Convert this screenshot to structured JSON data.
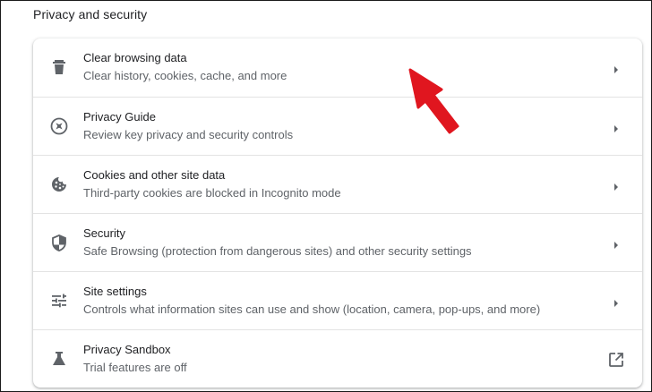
{
  "section": {
    "title": "Privacy and security"
  },
  "rows": [
    {
      "label": "Clear browsing data",
      "sub": "Clear history, cookies, cache, and more",
      "icon": "trash-icon",
      "action": "chevron-right-icon"
    },
    {
      "label": "Privacy Guide",
      "sub": "Review key privacy and security controls",
      "icon": "compass-icon",
      "action": "chevron-right-icon"
    },
    {
      "label": "Cookies and other site data",
      "sub": "Third-party cookies are blocked in Incognito mode",
      "icon": "cookie-icon",
      "action": "chevron-right-icon"
    },
    {
      "label": "Security",
      "sub": "Safe Browsing (protection from dangerous sites) and other security settings",
      "icon": "shield-icon",
      "action": "chevron-right-icon"
    },
    {
      "label": "Site settings",
      "sub": "Controls what information sites can use and show (location, camera, pop-ups, and more)",
      "icon": "tune-sliders-icon",
      "action": "chevron-right-icon"
    },
    {
      "label": "Privacy Sandbox",
      "sub": "Trial features are off",
      "icon": "flask-icon",
      "action": "open-in-new-icon"
    }
  ],
  "colors": {
    "annotation_arrow": "#e0161f",
    "icon": "#5f6368",
    "text_primary": "#202124",
    "text_secondary": "#5f6368"
  }
}
